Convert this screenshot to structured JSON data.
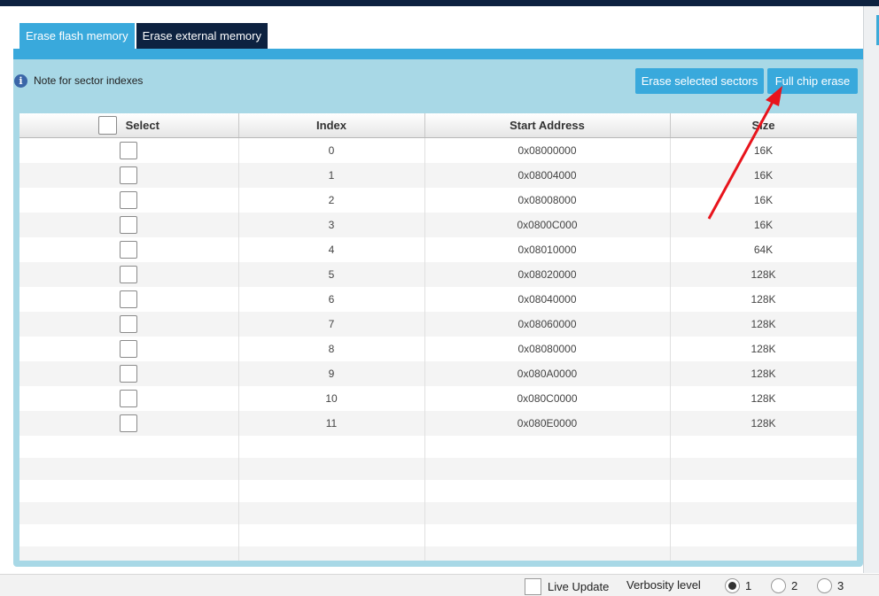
{
  "tabs": [
    {
      "label": "Erase flash memory",
      "active": true
    },
    {
      "label": "Erase external memory",
      "active": false
    }
  ],
  "note": {
    "icon": "info-icon",
    "label": "Note for sector indexes"
  },
  "buttons": {
    "erase_selected": "Erase selected sectors",
    "full_chip_erase": "Full chip erase"
  },
  "table": {
    "columns": [
      "Select",
      "Index",
      "Start Address",
      "Size"
    ],
    "rows": [
      {
        "index": "0",
        "address": "0x08000000",
        "size": "16K"
      },
      {
        "index": "1",
        "address": "0x08004000",
        "size": "16K"
      },
      {
        "index": "2",
        "address": "0x08008000",
        "size": "16K"
      },
      {
        "index": "3",
        "address": "0x0800C000",
        "size": "16K"
      },
      {
        "index": "4",
        "address": "0x08010000",
        "size": "64K"
      },
      {
        "index": "5",
        "address": "0x08020000",
        "size": "128K"
      },
      {
        "index": "6",
        "address": "0x08040000",
        "size": "128K"
      },
      {
        "index": "7",
        "address": "0x08060000",
        "size": "128K"
      },
      {
        "index": "8",
        "address": "0x08080000",
        "size": "128K"
      },
      {
        "index": "9",
        "address": "0x080A0000",
        "size": "128K"
      },
      {
        "index": "10",
        "address": "0x080C0000",
        "size": "128K"
      },
      {
        "index": "11",
        "address": "0x080E0000",
        "size": "128K"
      }
    ],
    "empty_rows": 6
  },
  "status": {
    "live_update": "Live Update",
    "verbosity_label": "Verbosity level",
    "verbosity_options": [
      "1",
      "2",
      "3"
    ],
    "verbosity_selected": "1"
  },
  "colors": {
    "accent": "#39a9dc",
    "dark": "#0d2240",
    "panel": "#a8d8e6",
    "annotation": "#e8141c"
  }
}
